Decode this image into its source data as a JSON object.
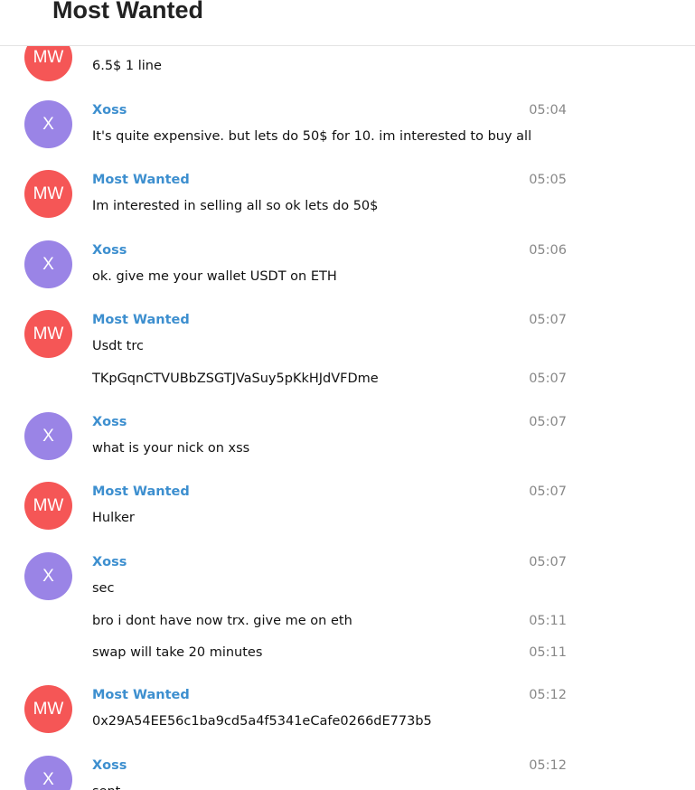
{
  "chat": {
    "title": "Most Wanted"
  },
  "colors": {
    "mw_avatar": "#f55656",
    "x_avatar": "#9a84e6",
    "sender_name": "#3d8fcf",
    "timestamp": "#888888"
  },
  "messages": [
    {
      "avatar": "MW",
      "text": "6.5$ 1 line"
    },
    {
      "avatar": "X",
      "sender": "Xoss",
      "time": "05:04",
      "text": "It's quite expensive. but lets do 50$ for 10. im interested to buy all"
    },
    {
      "avatar": "MW",
      "sender": "Most Wanted",
      "time": "05:05",
      "text": "Im interested in selling all so ok lets do 50$"
    },
    {
      "avatar": "X",
      "sender": "Xoss",
      "time": "05:06",
      "text": "ok. give me your wallet USDT on ETH"
    },
    {
      "avatar": "MW",
      "sender": "Most Wanted",
      "time": "05:07",
      "text": "Usdt trc"
    },
    {
      "time": "05:07",
      "text": "TKpGqnCTVUBbZSGTJVaSuy5pKkHJdVFDme"
    },
    {
      "avatar": "X",
      "sender": "Xoss",
      "time": "05:07",
      "text": "what is your nick on xss"
    },
    {
      "avatar": "MW",
      "sender": "Most Wanted",
      "time": "05:07",
      "text": "Hulker"
    },
    {
      "avatar": "X",
      "sender": "Xoss",
      "time": "05:07",
      "text": "sec"
    },
    {
      "time": "05:11",
      "text": "bro i dont have now trx. give me on eth"
    },
    {
      "time": "05:11",
      "text": "swap will take 20 minutes"
    },
    {
      "avatar": "MW",
      "sender": "Most Wanted",
      "time": "05:12",
      "text": "0x29A54EE56c1ba9cd5a4f5341eCafe0266dE773b5"
    },
    {
      "avatar": "X",
      "sender": "Xoss",
      "time": "05:12",
      "text": "sent"
    }
  ]
}
